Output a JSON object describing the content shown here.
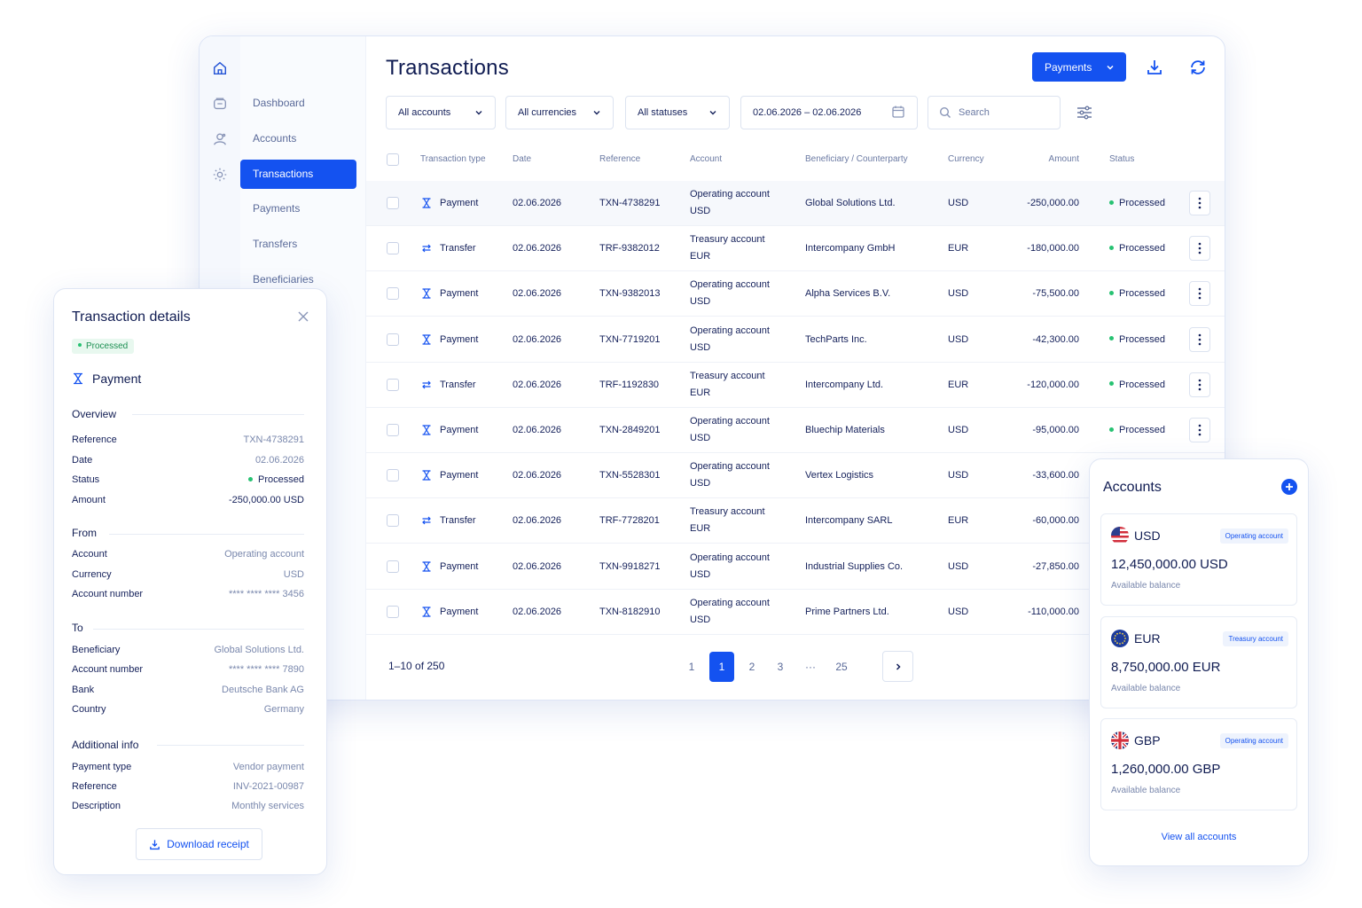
{
  "sidebar": {
    "rail_icons": [
      "home-icon",
      "wallet-icon",
      "accounts-icon",
      "settings-icon"
    ],
    "items": [
      {
        "label": "Dashboard",
        "active": false
      },
      {
        "label": "Accounts",
        "active": false
      },
      {
        "label": "Transactions",
        "active": true
      },
      {
        "label": "Payments",
        "active": false
      },
      {
        "label": "Transfers",
        "active": false
      },
      {
        "label": "Beneficiaries",
        "active": false
      }
    ]
  },
  "header": {
    "title": "Transactions",
    "payments_button": "Payments"
  },
  "filters": {
    "accounts": "All accounts",
    "currencies": "All currencies",
    "statuses": "All statuses",
    "date_range": "02.06.2026 – 02.06.2026",
    "search_placeholder": "Search"
  },
  "table": {
    "columns": [
      "Transaction type",
      "Date",
      "Reference",
      "Account",
      "Beneficiary / Counterparty",
      "Currency",
      "Amount",
      "Status"
    ],
    "rows": [
      {
        "type": "Payment",
        "date": "02.06.2026",
        "reference": "TXN-4738291",
        "account": "Operating account",
        "account_cur": "USD",
        "beneficiary": "Global Solutions Ltd.",
        "currency": "USD",
        "amount": "-250,000.00",
        "status": "Processed"
      },
      {
        "type": "Transfer",
        "date": "02.06.2026",
        "reference": "TRF-9382012",
        "account": "Treasury account",
        "account_cur": "EUR",
        "beneficiary": "Intercompany GmbH",
        "currency": "EUR",
        "amount": "-180,000.00",
        "status": "Processed"
      },
      {
        "type": "Payment",
        "date": "02.06.2026",
        "reference": "TXN-9382013",
        "account": "Operating account",
        "account_cur": "USD",
        "beneficiary": "Alpha Services B.V.",
        "currency": "USD",
        "amount": "-75,500.00",
        "status": "Processed"
      },
      {
        "type": "Payment",
        "date": "02.06.2026",
        "reference": "TXN-7719201",
        "account": "Operating account",
        "account_cur": "USD",
        "beneficiary": "TechParts Inc.",
        "currency": "USD",
        "amount": "-42,300.00",
        "status": "Processed"
      },
      {
        "type": "Transfer",
        "date": "02.06.2026",
        "reference": "TRF-1192830",
        "account": "Treasury account",
        "account_cur": "EUR",
        "beneficiary": "Intercompany Ltd.",
        "currency": "EUR",
        "amount": "-120,000.00",
        "status": "Processed"
      },
      {
        "type": "Payment",
        "date": "02.06.2026",
        "reference": "TXN-2849201",
        "account": "Operating account",
        "account_cur": "USD",
        "beneficiary": "Bluechip Materials",
        "currency": "USD",
        "amount": "-95,000.00",
        "status": "Processed"
      },
      {
        "type": "Payment",
        "date": "02.06.2026",
        "reference": "TXN-5528301",
        "account": "Operating account",
        "account_cur": "USD",
        "beneficiary": "Vertex Logistics",
        "currency": "USD",
        "amount": "-33,600.00",
        "status": ""
      },
      {
        "type": "Transfer",
        "date": "02.06.2026",
        "reference": "TRF-7728201",
        "account": "Treasury account",
        "account_cur": "EUR",
        "beneficiary": "Intercompany SARL",
        "currency": "EUR",
        "amount": "-60,000.00",
        "status": ""
      },
      {
        "type": "Payment",
        "date": "02.06.2026",
        "reference": "TXN-9918271",
        "account": "Operating account",
        "account_cur": "USD",
        "beneficiary": "Industrial Supplies Co.",
        "currency": "USD",
        "amount": "-27,850.00",
        "status": ""
      },
      {
        "type": "Payment",
        "date": "02.06.2026",
        "reference": "TXN-8182910",
        "account": "Operating account",
        "account_cur": "USD",
        "beneficiary": "Prime Partners Ltd.",
        "currency": "USD",
        "amount": "-110,000.00",
        "status": ""
      }
    ]
  },
  "pagination": {
    "count": "1–10 of 250",
    "pages": [
      "1",
      "1",
      "2",
      "3",
      "···",
      "25"
    ],
    "active_index": 1
  },
  "details": {
    "title": "Transaction details",
    "badge": "Processed",
    "type": "Payment",
    "overview_title": "Overview",
    "overview": [
      {
        "k": "Reference",
        "v": "TXN-4738291"
      },
      {
        "k": "Date",
        "v": "02.06.2026"
      },
      {
        "k": "Status",
        "v": "Processed"
      },
      {
        "k": "Amount",
        "v": "-250,000.00 USD"
      }
    ],
    "from_title": "From",
    "from": [
      {
        "k": "Account",
        "v": "Operating account"
      },
      {
        "k": "Currency",
        "v": "USD"
      },
      {
        "k": "Account number",
        "v": "**** **** **** 3456"
      }
    ],
    "to_title": "To",
    "to": [
      {
        "k": "Beneficiary",
        "v": "Global Solutions Ltd."
      },
      {
        "k": "Account number",
        "v": "**** **** **** 7890"
      },
      {
        "k": "Bank",
        "v": "Deutsche Bank AG"
      },
      {
        "k": "Country",
        "v": "Germany"
      }
    ],
    "additional_title": "Additional info",
    "additional": [
      {
        "k": "Payment type",
        "v": "Vendor payment"
      },
      {
        "k": "Reference",
        "v": "INV-2021-00987"
      },
      {
        "k": "Description",
        "v": "Monthly services"
      }
    ],
    "download_label": "Download receipt"
  },
  "accounts_panel": {
    "title": "Accounts",
    "cards": [
      {
        "currency": "USD",
        "flag": "us-flag-icon",
        "tag": "Operating account",
        "balance": "12,450,000.00 USD",
        "label": "Available balance"
      },
      {
        "currency": "EUR",
        "flag": "eu-flag-icon",
        "tag": "Treasury account",
        "balance": "8,750,000.00 EUR",
        "label": "Available balance"
      },
      {
        "currency": "GBP",
        "flag": "gb-flag-icon",
        "tag": "Operating account",
        "balance": "1,260,000.00 GBP",
        "label": "Available balance"
      }
    ],
    "view_all": "View all accounts"
  },
  "colors": {
    "primary": "#1452f0",
    "processed": "#27c272",
    "text": "#14205a",
    "muted": "#7a88ad"
  }
}
